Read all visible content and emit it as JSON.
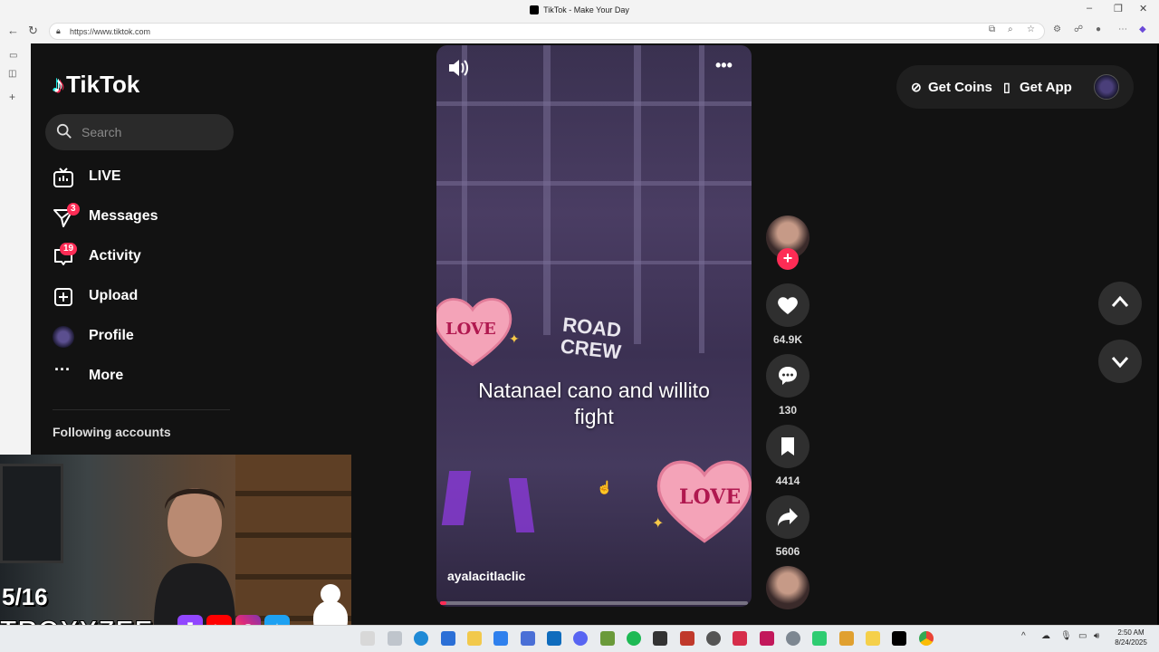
{
  "browser": {
    "tab_title": "TikTok - Make Your Day",
    "url": "https://www.tiktok.com"
  },
  "sidebar": {
    "logo_text": "TikTok",
    "search_placeholder": "Search",
    "items": [
      {
        "label": "LIVE",
        "icon": "live-tv-icon"
      },
      {
        "label": "Messages",
        "icon": "paper-plane-icon",
        "badge": "3"
      },
      {
        "label": "Activity",
        "icon": "activity-icon",
        "badge": "19"
      },
      {
        "label": "Upload",
        "icon": "upload-plus-icon"
      },
      {
        "label": "Profile",
        "icon": "avatar"
      },
      {
        "label": "More",
        "icon": "more-dots-icon"
      }
    ],
    "following_header": "Following accounts"
  },
  "video": {
    "caption": "Natanael cano and willito fight",
    "author": "ayalacitlaclic",
    "shirt_text": "ROAD\nCREW",
    "sticker_text": "LOVE",
    "progress": 0.02
  },
  "actions": {
    "likes": "64.9K",
    "comments": "130",
    "saves": "4414",
    "shares": "5606"
  },
  "topbar": {
    "get_coins": "Get Coins",
    "get_app": "Get App"
  },
  "stream_overlay": {
    "counter": "5/16",
    "channel": "TROYYZEE"
  },
  "taskbar": {
    "time": "2:50 AM",
    "date": "8/24/2025"
  },
  "colors": {
    "accent": "#fe2c55",
    "background": "#121212",
    "rail_button": "#2f2f2f"
  }
}
